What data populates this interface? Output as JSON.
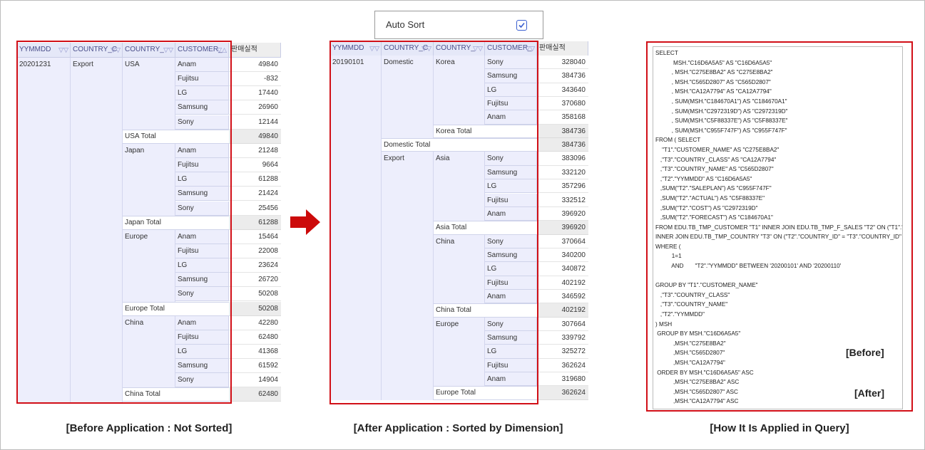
{
  "left_grid": {
    "headers": [
      "YYMMDD",
      "COUNTRY_C",
      "COUNTRY_",
      "CUSTOMER_",
      "판매실적"
    ],
    "yymmdd": "20201231",
    "country_class": "Export",
    "groups": [
      {
        "country": "USA",
        "rows": [
          [
            "Anam",
            "49840"
          ],
          [
            "Fujitsu",
            "-832"
          ],
          [
            "LG",
            "17440"
          ],
          [
            "Samsung",
            "26960"
          ],
          [
            "Sony",
            "12144"
          ]
        ],
        "total_label": "USA Total",
        "total": "49840"
      },
      {
        "country": "Japan",
        "rows": [
          [
            "Anam",
            "21248"
          ],
          [
            "Fujitsu",
            "9664"
          ],
          [
            "LG",
            "61288"
          ],
          [
            "Samsung",
            "21424"
          ],
          [
            "Sony",
            "25456"
          ]
        ],
        "total_label": "Japan Total",
        "total": "61288"
      },
      {
        "country": "Europe",
        "rows": [
          [
            "Anam",
            "15464"
          ],
          [
            "Fujitsu",
            "22008"
          ],
          [
            "LG",
            "23624"
          ],
          [
            "Samsung",
            "26720"
          ],
          [
            "Sony",
            "50208"
          ]
        ],
        "total_label": "Europe Total",
        "total": "50208"
      },
      {
        "country": "China",
        "rows": [
          [
            "Anam",
            "42280"
          ],
          [
            "Fujitsu",
            "62480"
          ],
          [
            "LG",
            "41368"
          ],
          [
            "Samsung",
            "61592"
          ],
          [
            "Sony",
            "14904"
          ]
        ],
        "total_label": "China Total",
        "total": "62480"
      }
    ]
  },
  "right_grid": {
    "headers": [
      "YYMMDD",
      "COUNTRY_C",
      "COUNTRY_",
      "CUSTOMER_",
      "판매실적"
    ],
    "yymmdd": "20190101",
    "domestic": {
      "class": "Domestic",
      "groups": [
        {
          "country": "Korea",
          "rows": [
            [
              "Sony",
              "328040"
            ],
            [
              "Samsung",
              "384736"
            ],
            [
              "LG",
              "343640"
            ],
            [
              "Fujitsu",
              "370680"
            ],
            [
              "Anam",
              "358168"
            ]
          ],
          "total_label": "Korea Total",
          "total": "384736"
        }
      ],
      "total_label": "Domestic Total",
      "total": "384736"
    },
    "export": {
      "class": "Export",
      "groups": [
        {
          "country": "Asia",
          "rows": [
            [
              "Sony",
              "383096"
            ],
            [
              "Samsung",
              "332120"
            ],
            [
              "LG",
              "357296"
            ],
            [
              "Fujitsu",
              "332512"
            ],
            [
              "Anam",
              "396920"
            ]
          ],
          "total_label": "Asia Total",
          "total": "396920"
        },
        {
          "country": "China",
          "rows": [
            [
              "Sony",
              "370664"
            ],
            [
              "Samsung",
              "340200"
            ],
            [
              "LG",
              "340872"
            ],
            [
              "Fujitsu",
              "402192"
            ],
            [
              "Anam",
              "346592"
            ]
          ],
          "total_label": "China Total",
          "total": "402192"
        },
        {
          "country": "Europe",
          "rows": [
            [
              "Sony",
              "307664"
            ],
            [
              "Samsung",
              "339792"
            ],
            [
              "LG",
              "325272"
            ],
            [
              "Fujitsu",
              "362624"
            ],
            [
              "Anam",
              "319680"
            ]
          ],
          "total_label": "Europe Total",
          "total": "362624"
        }
      ]
    }
  },
  "auto_sort": {
    "label": "Auto Sort",
    "checked": true
  },
  "query": {
    "lines": [
      "SELECT",
      "           MSH.\"C16D6A5A5\" AS \"C16D6A5A5\"",
      "          , MSH.\"C275E8BA2\" AS \"C275E8BA2\"",
      "          , MSH.\"C565D2807\" AS \"C565D2807\"",
      "          , MSH.\"CA12A7794\" AS \"CA12A7794\"",
      "          , SUM(MSH.\"C184670A1\") AS \"C184670A1\"",
      "          , SUM(MSH.\"C2972319D\") AS \"C2972319D\"",
      "          , SUM(MSH.\"C5F88337E\") AS \"C5F88337E\"",
      "          , SUM(MSH.\"C955F747F\") AS \"C955F747F\"",
      "FROM ( SELECT",
      "    \"T1\".\"CUSTOMER_NAME\" AS \"C275E8BA2\"",
      "   ,\"T3\".\"COUNTRY_CLASS\" AS \"CA12A7794\"",
      "   ,\"T3\".\"COUNTRY_NAME\" AS \"C565D2807\"",
      "   ,\"T2\".\"YYMMDD\" AS \"C16D6A5A5\"",
      "   ,SUM(\"T2\".\"SALEPLAN\") AS \"C955F747F\"",
      "   ,SUM(\"T2\".\"ACTUAL\") AS \"C5F88337E\"",
      "   ,SUM(\"T2\".\"COST\") AS \"C2972319D\"",
      "   ,SUM(\"T2\".\"FORECAST\") AS \"C184670A1\"",
      "FROM EDU.TB_TMP_CUSTOMER \"T1\" INNER JOIN EDU.TB_TMP_F_SALES \"T2\" ON (\"T1\".\"CUST",
      "INNER JOIN EDU.TB_TMP_COUNTRY \"T3\" ON (\"T2\".\"COUNTRY_ID\" = \"T3\".\"COUNTRY_ID\" )",
      "WHERE (",
      "          1=1",
      "          AND       \"T2\".\"YYMMDD\" BETWEEN '20200101' AND '20200110'",
      "",
      "GROUP BY \"T1\".\"CUSTOMER_NAME\"",
      "   ,\"T3\".\"COUNTRY_CLASS\"",
      "   ,\"T3\".\"COUNTRY_NAME\"",
      "   ,\"T2\".\"YYMMDD\"",
      ") MSH",
      " GROUP BY MSH.\"C16D6A5A5\"",
      "           ,MSH.\"C275E8BA2\"",
      "           ,MSH.\"C565D2807\"",
      "           ,MSH.\"CA12A7794\"",
      " ORDER BY MSH.\"C16D6A5A5\" ASC",
      "           ,MSH.\"C275E8BA2\" ASC",
      "           ,MSH.\"C565D2807\" ASC",
      "           ,MSH.\"CA12A7794\" ASC"
    ],
    "before_tag": "[Before]",
    "after_tag": "[After]"
  },
  "captions": {
    "left": "[Before Application : Not Sorted]",
    "middle": "[After Application : Sorted by Dimension]",
    "right": "[How It Is Applied in Query]"
  },
  "colors": {
    "highlight": "#d10f17",
    "arrow": "#cc0a0a",
    "header": "#e5e8f8"
  }
}
